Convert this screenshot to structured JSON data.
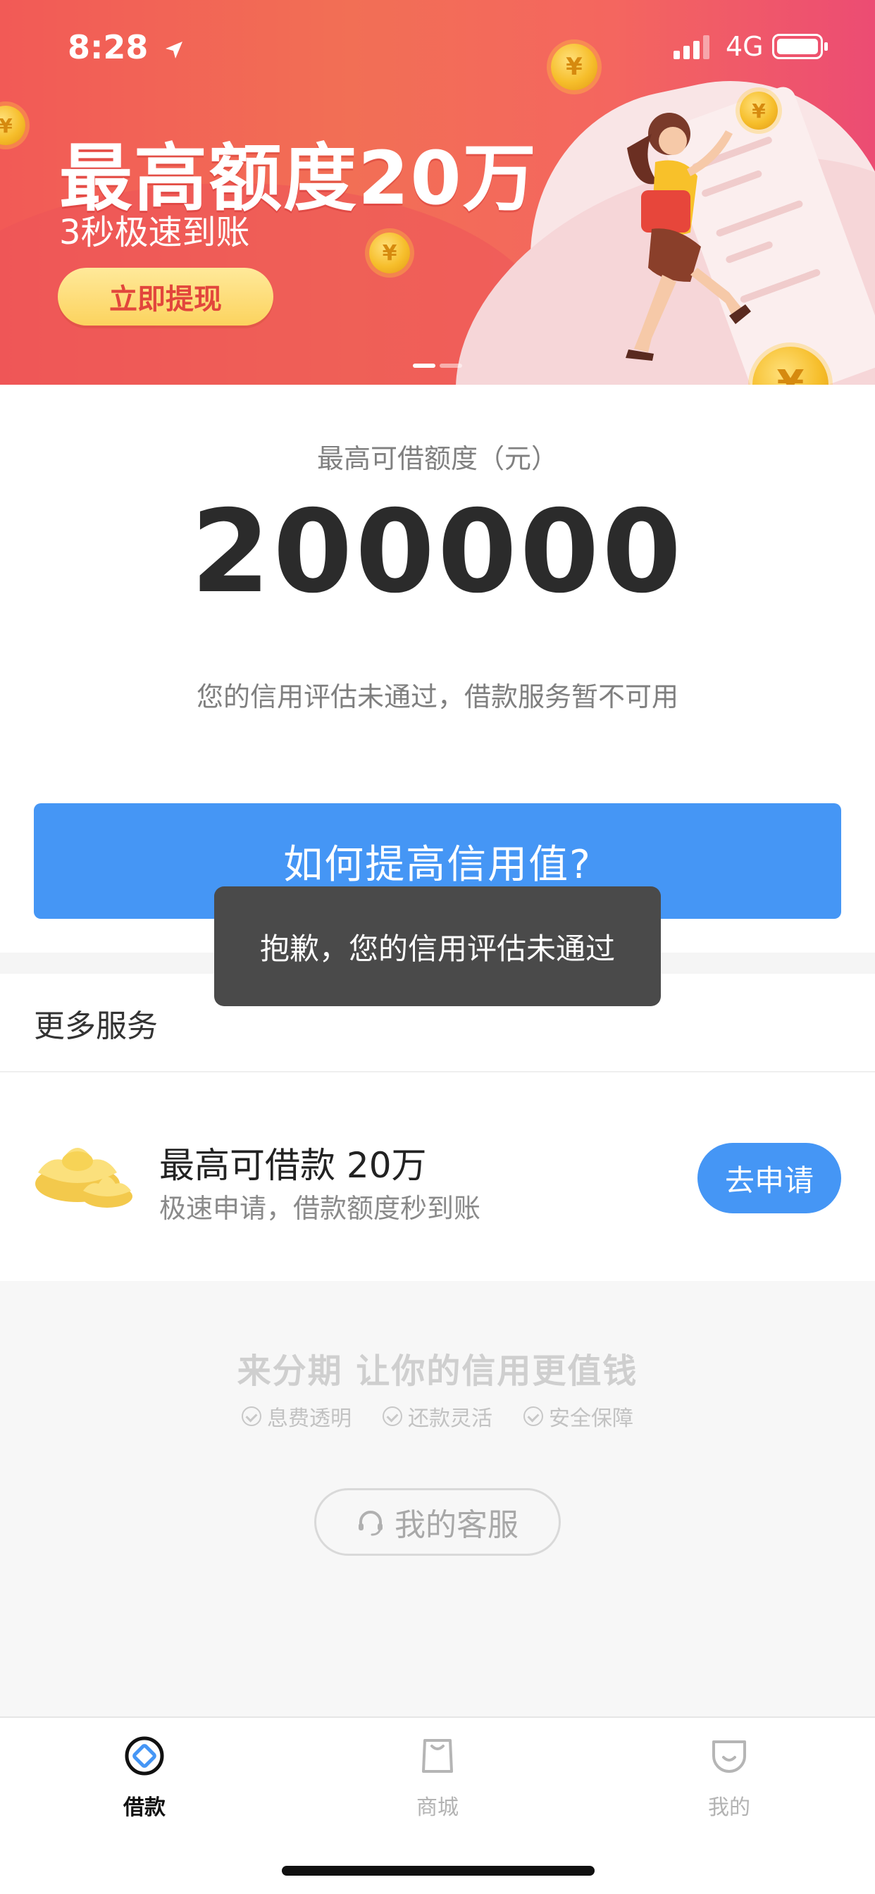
{
  "status_bar": {
    "time": "8:28",
    "network": "4G"
  },
  "banner": {
    "title": "最高额度20万",
    "subtitle": "3秒极速到账",
    "cta": "立即提现",
    "coin_symbol": "¥",
    "carousel_count": 2,
    "carousel_active": 1
  },
  "quota": {
    "label": "最高可借额度（元）",
    "value": "200000",
    "note": "您的信用评估未通过，借款服务暂不可用"
  },
  "main_button": {
    "label": "如何提高信用值?"
  },
  "toast": {
    "message": "抱歉，您的信用评估未通过"
  },
  "more_services": {
    "title": "更多服务",
    "item": {
      "title": "最高可借款 20万",
      "subtitle": "极速申请，借款额度秒到账",
      "button": "去申请"
    }
  },
  "footer": {
    "slogan": "来分期  让你的信用更值钱",
    "features": [
      "息费透明",
      "还款灵活",
      "安全保障"
    ],
    "customer_service": "我的客服"
  },
  "tabbar": {
    "tabs": [
      {
        "label": "借款",
        "icon": "loan-icon",
        "active": true
      },
      {
        "label": "商城",
        "icon": "shop-icon",
        "active": false
      },
      {
        "label": "我的",
        "icon": "profile-icon",
        "active": false
      }
    ]
  },
  "colors": {
    "primary_blue": "#4596f5",
    "banner_red": "#f25a56",
    "toast_bg": "#4a4a4a"
  }
}
